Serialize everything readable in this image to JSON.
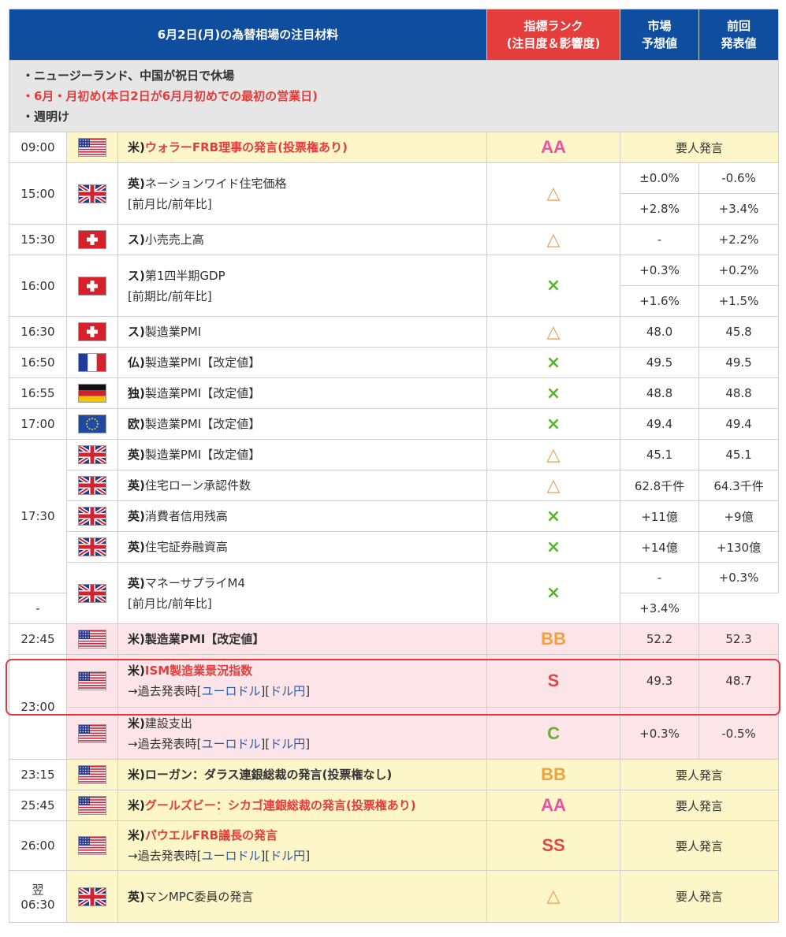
{
  "header": {
    "title": "6月2日(月)の為替相場の注目材料",
    "rank_line1": "指標ランク",
    "rank_line2": "(注目度＆影響度)",
    "forecast_line1": "市場",
    "forecast_line2": "予想値",
    "previous_line1": "前回",
    "previous_line2": "発表値"
  },
  "notes": [
    {
      "text": "・ニュージーランド、中国が祝日で休場",
      "color": "#333333"
    },
    {
      "text": "・6月・月初め(本日2日が6月月初めでの最初の営業日)",
      "color": "#e53c3c"
    },
    {
      "text": "・週明け",
      "color": "#333333"
    }
  ],
  "link_prefix": "→過去発表時",
  "link_eurusd": "ユーロドル",
  "link_usdjpy": "ドル円",
  "rows": [
    {
      "time": "09:00",
      "flag": "us-flag",
      "prefix": "米)",
      "event": "ウォラーFRB理事の発言(投票権あり)",
      "style": "red-bold",
      "rank": "AA",
      "speech": "要人発言",
      "bg": "yellow"
    },
    {
      "time": "15:00",
      "flag": "uk-flag",
      "prefix": "英)",
      "event": "ネーションワイド住宅価格",
      "sub": "[前月比/前年比]",
      "rank": "△",
      "forecast": "±0.0%",
      "previous": "-0.6%",
      "forecast2": "+2.8%",
      "previous2": "+3.4%"
    },
    {
      "time": "15:30",
      "flag": "swiss-flag",
      "prefix": "ス)",
      "event": "小売売上高",
      "rank": "△",
      "forecast": "-",
      "previous": "+2.2%"
    },
    {
      "time": "16:00",
      "flag": "swiss-flag",
      "prefix": "ス)",
      "event": "第1四半期GDP",
      "sub": "[前期比/前年比]",
      "rank": "×",
      "forecast": "+0.3%",
      "previous": "+0.2%",
      "forecast2": "+1.6%",
      "previous2": "+1.5%"
    },
    {
      "time": "16:30",
      "flag": "swiss-flag",
      "prefix": "ス)",
      "event": "製造業PMI",
      "rank": "△",
      "forecast": "48.0",
      "previous": "45.8"
    },
    {
      "time": "16:50",
      "flag": "france-flag",
      "prefix": "仏)",
      "event": "製造業PMI【改定値】",
      "rank": "×",
      "forecast": "49.5",
      "previous": "49.5"
    },
    {
      "time": "16:55",
      "flag": "germany-flag",
      "prefix": "独)",
      "event": "製造業PMI【改定値】",
      "rank": "×",
      "forecast": "48.8",
      "previous": "48.8"
    },
    {
      "time": "17:00",
      "flag": "eu-flag",
      "prefix": "欧)",
      "event": "製造業PMI【改定値】",
      "rank": "×",
      "forecast": "49.4",
      "previous": "49.4"
    },
    {
      "time": "17:30",
      "flag": "uk-flag",
      "prefix": "英)",
      "event": "製造業PMI【改定値】",
      "rank": "△",
      "forecast": "45.1",
      "previous": "45.1"
    },
    {
      "flag": "uk-flag",
      "prefix": "英)",
      "event": "住宅ローン承認件数",
      "rank": "△",
      "forecast": "62.8千件",
      "previous": "64.3千件"
    },
    {
      "flag": "uk-flag",
      "prefix": "英)",
      "event": "消費者信用残高",
      "rank": "×",
      "forecast": "+11億",
      "previous": "+9億"
    },
    {
      "flag": "uk-flag",
      "prefix": "英)",
      "event": "住宅証券融資高",
      "rank": "×",
      "forecast": "+14億",
      "previous": "+130億"
    },
    {
      "flag": "uk-flag",
      "prefix": "英)",
      "event": "マネーサプライM4",
      "sub": "[前月比/前年比]",
      "rank": "×",
      "forecast": "-",
      "previous": "+0.3%",
      "forecast2": "-",
      "previous2": "+3.4%"
    },
    {
      "time": "22:45",
      "flag": "us-flag",
      "prefix": "米)",
      "event": "製造業PMI【改定値】",
      "style": "bold",
      "rank": "BB",
      "forecast": "52.2",
      "previous": "52.3",
      "bg": "pink"
    },
    {
      "time": "23:00",
      "flag": "us-flag",
      "prefix": "米)",
      "event": "ISM製造業景況指数",
      "style": "red-bold",
      "links": true,
      "rank": "S",
      "forecast": "49.3",
      "previous": "48.7",
      "bg": "pink"
    },
    {
      "flag": "us-flag",
      "prefix": "米)",
      "event": "建設支出",
      "links": true,
      "rank": "C",
      "forecast": "+0.3%",
      "previous": "-0.5%",
      "bg": "pink"
    },
    {
      "time": "23:15",
      "flag": "us-flag",
      "prefix": "米)",
      "event": "ローガン：ダラス連銀総裁の発言(投票権なし)",
      "style": "bold",
      "rank": "BB",
      "speech": "要人発言",
      "bg": "yellow"
    },
    {
      "time": "25:45",
      "flag": "us-flag",
      "prefix": "米)",
      "event": "グールズビー：シカゴ連銀総裁の発言(投票権あり)",
      "style": "red-bold",
      "rank": "AA",
      "speech": "要人発言",
      "bg": "yellow"
    },
    {
      "time": "26:00",
      "flag": "us-flag",
      "prefix": "米)",
      "event": "パウエルFRB議長の発言",
      "style": "red-bold",
      "links": true,
      "rank": "SS",
      "speech": "要人発言",
      "bg": "yellow"
    },
    {
      "time": "06:30",
      "time_top": "翌",
      "flag": "uk-flag",
      "prefix": "英)",
      "event": "マンMPC委員の発言",
      "rank": "△",
      "speech": "要人発言",
      "bg": "yellow"
    }
  ],
  "colors": {
    "header_blue": "#0f4d9f",
    "rank_header_red": "#e53c3c",
    "notes_bg": "#e6e6e6",
    "yellow_row": "#fdf6c8",
    "pink_row": "#fde4e8",
    "link_blue": "#1e5bb8",
    "highlight_border": "#e23a3a"
  }
}
